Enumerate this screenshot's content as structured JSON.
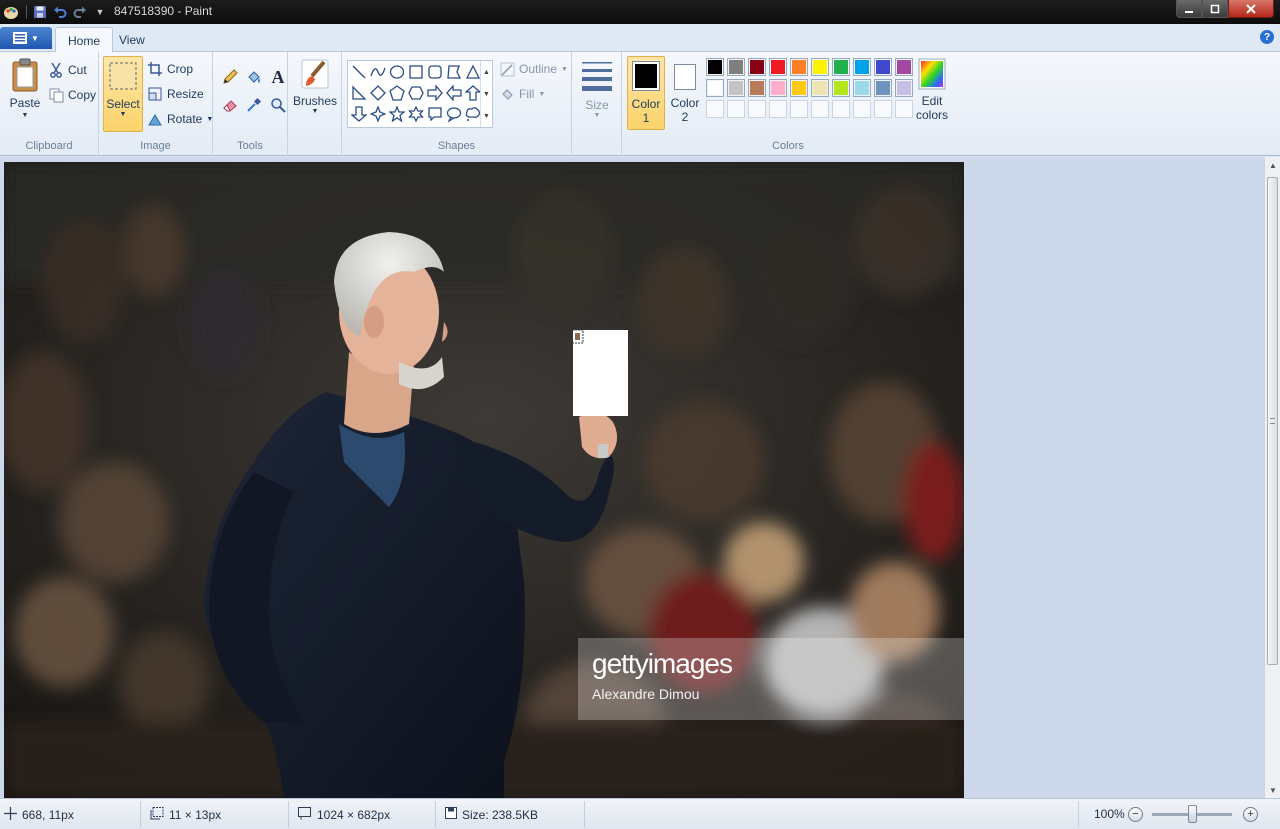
{
  "window": {
    "title": "847518390 - Paint"
  },
  "tabs": [
    {
      "label": "Home",
      "active": true
    },
    {
      "label": "View",
      "active": false
    }
  ],
  "ribbon": {
    "clipboard": {
      "label": "Clipboard",
      "paste": "Paste",
      "cut": "Cut",
      "copy": "Copy"
    },
    "image": {
      "label": "Image",
      "select": "Select",
      "crop": "Crop",
      "resize": "Resize",
      "rotate": "Rotate"
    },
    "tools": {
      "label": "Tools",
      "items": [
        "pencil-icon",
        "fill-bucket-icon",
        "text-icon",
        "eraser-icon",
        "color-picker-icon",
        "magnifier-icon"
      ]
    },
    "brushes": {
      "label": "Brushes"
    },
    "shapes": {
      "label": "Shapes",
      "outline": "Outline",
      "fill": "Fill"
    },
    "size": {
      "label": "Size"
    },
    "colors": {
      "label": "Colors",
      "color1": {
        "label_line1": "Color",
        "label_line2": "1",
        "value": "#000000"
      },
      "color2": {
        "label_line1": "Color",
        "label_line2": "2",
        "value": "#ffffff"
      },
      "edit_line1": "Edit",
      "edit_line2": "colors",
      "palette": [
        "#000000",
        "#7f7f7f",
        "#880015",
        "#ed1c24",
        "#ff7f27",
        "#fff200",
        "#22b14c",
        "#00a2e8",
        "#3f48cc",
        "#a349a4",
        "#ffffff",
        "#c3c3c3",
        "#b97a57",
        "#ffaec9",
        "#ffc90e",
        "#efe4b0",
        "#b5e61d",
        "#99d9ea",
        "#7092be",
        "#c8bfe7"
      ]
    }
  },
  "canvas": {
    "watermark_brand": "gettyimages",
    "watermark_credit": "Alexandre Dimou"
  },
  "status": {
    "cursor": "668, 11px",
    "selection": "11 × 13px",
    "image_size": "1024 × 682px",
    "file_size": "Size: 238.5KB",
    "zoom": "100%",
    "zoom_level": 1.0
  }
}
